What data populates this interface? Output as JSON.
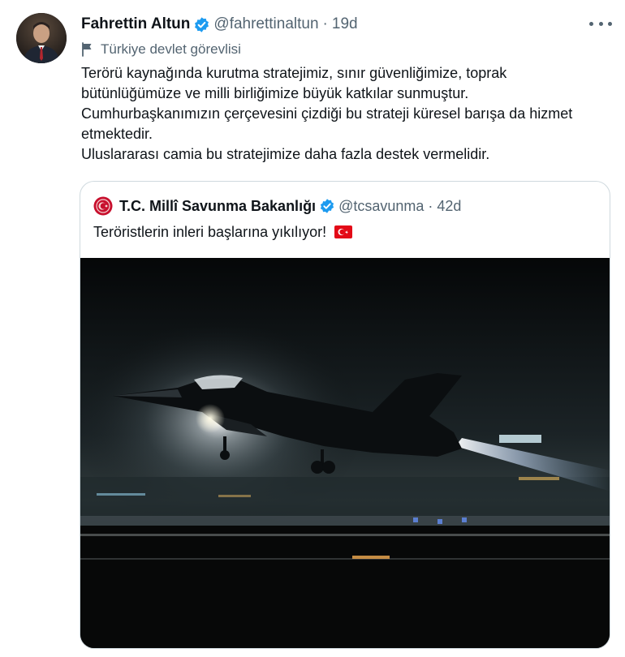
{
  "tweet": {
    "author": {
      "display_name": "Fahrettin Altun",
      "handle": "@fahrettinaltun",
      "time": "19d",
      "verified": true
    },
    "separator": "·",
    "label": "Türkiye devlet görevlisi",
    "text_lines": [
      "Terörü kaynağında kurutma stratejimiz, sınır güvenliğimize, toprak",
      "bütünlüğümüze ve milli birliğimize büyük katkılar sunmuştur.",
      "Cumhurbaşkanımızın çerçevesini çizdiği bu strateji küresel barışa da hizmet",
      "etmektedir.",
      "Uluslararası camia bu stratejimize daha fazla destek vermelidir."
    ]
  },
  "quote": {
    "author": {
      "display_name": "T.C. Millî Savunma Bakanlığı",
      "handle": "@tcsavunma",
      "time": "42d",
      "verified": true
    },
    "separator": "·",
    "text": "Teröristlerin inleri başlarına yıkılıyor!",
    "emoji": "turkey-flag-icon"
  },
  "colors": {
    "verified_blue": "#1d9bf0",
    "secondary_text": "#536471",
    "primary_text": "#0f1419",
    "border": "#cfd9de"
  }
}
